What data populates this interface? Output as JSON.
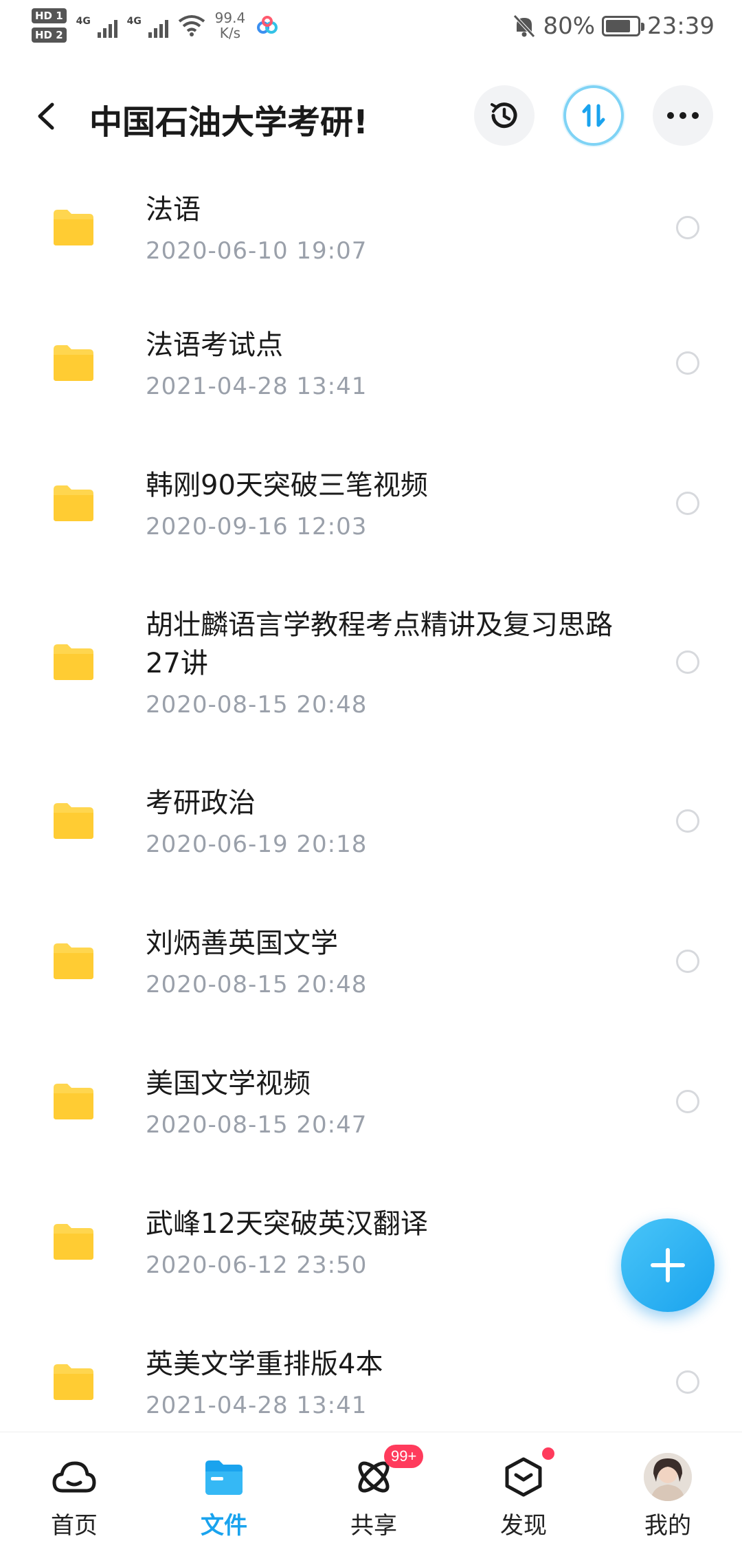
{
  "status_bar": {
    "sim1": "HD 1",
    "sim2": "HD 2",
    "net1": "4G",
    "net2": "4G",
    "speed_value": "99.4",
    "speed_unit": "K/s",
    "battery": "80%",
    "battery_level": 0.8,
    "time": "23:39"
  },
  "header": {
    "title": "中国石油大学考研!"
  },
  "files": [
    {
      "name": "法语",
      "date": "2020-06-10  19:07"
    },
    {
      "name": "法语考试点",
      "date": "2021-04-28  13:41"
    },
    {
      "name": "韩刚90天突破三笔视频",
      "date": "2020-09-16  12:03"
    },
    {
      "name": "胡壮麟语言学教程考点精讲及复习思路 27讲",
      "date": "2020-08-15  20:48"
    },
    {
      "name": "考研政治",
      "date": "2020-06-19  20:18"
    },
    {
      "name": "刘炳善英国文学",
      "date": "2020-08-15  20:48"
    },
    {
      "name": "美国文学视频",
      "date": "2020-08-15  20:47"
    },
    {
      "name": "武峰12天突破英汉翻译",
      "date": "2020-06-12  23:50"
    },
    {
      "name": "英美文学重排版4本",
      "date": "2021-04-28  13:41"
    }
  ],
  "nav": {
    "home": "首页",
    "files": "文件",
    "share": "共享",
    "share_badge": "99+",
    "discover": "发现",
    "mine": "我的"
  },
  "colors": {
    "accent": "#1aa3ee",
    "folder": "#ffd64f",
    "date_text": "#9aa0aa",
    "badge": "#ff3b5c"
  }
}
